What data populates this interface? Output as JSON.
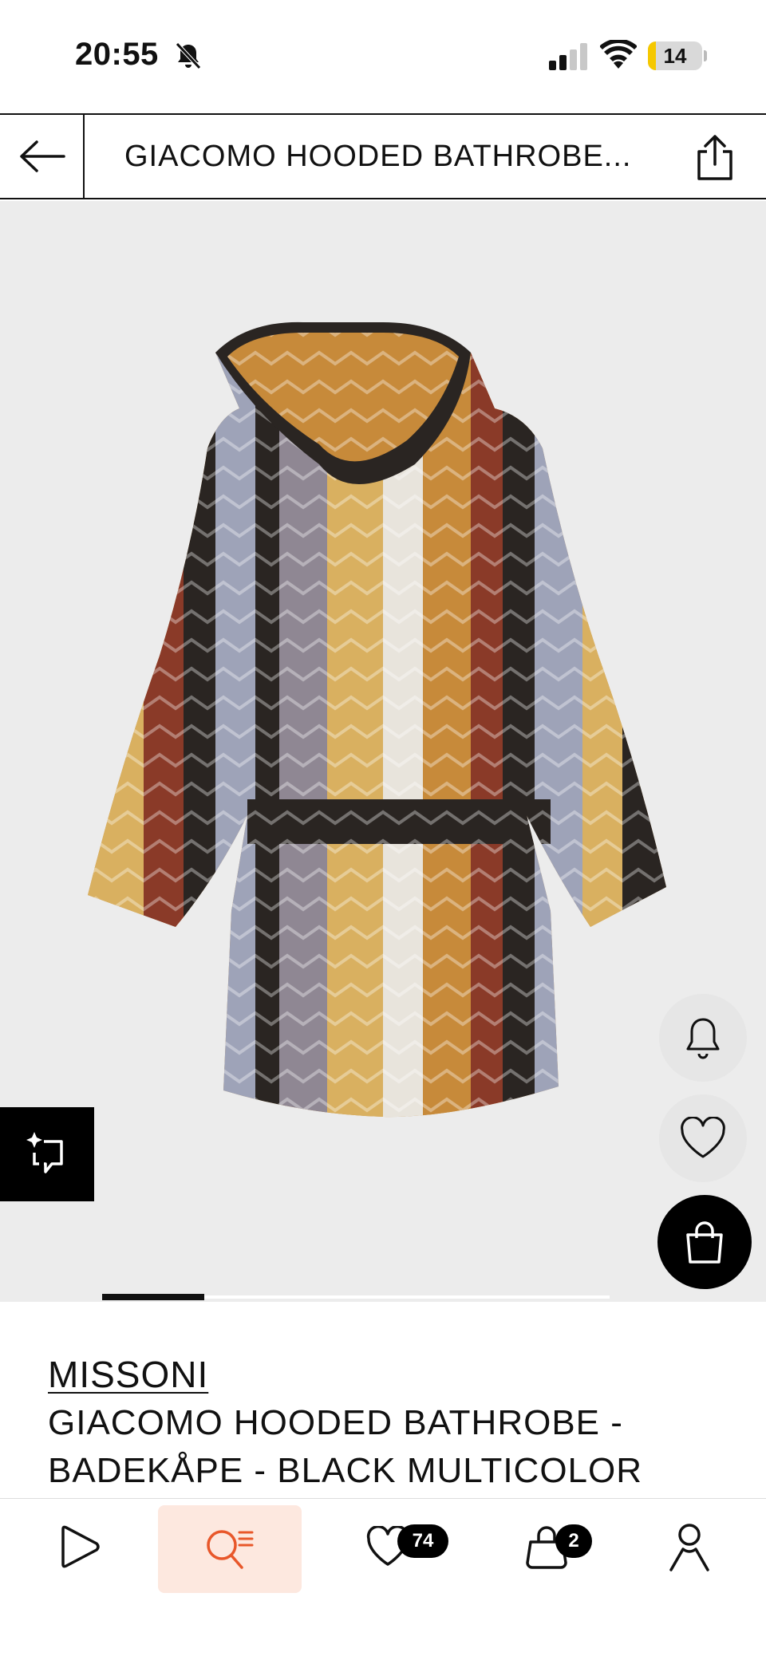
{
  "status_bar": {
    "time": "20:55",
    "battery": "14",
    "battery_level": 0.14
  },
  "header": {
    "title": "GIACOMO HOODED BATHROBE..."
  },
  "product": {
    "brand": "MISSONI",
    "name": "GIACOMO HOODED BATHROBE  - BADEKÅPE - BLACK MULTICOLOR",
    "colors": [
      "#c78a3a",
      "#2a2522",
      "#9ea3b8",
      "#8a3a28",
      "#d9b060",
      "#e8e4dc"
    ]
  },
  "gallery": {
    "active_index": 1
  },
  "nav": {
    "wishlist_count": "74",
    "bag_count": "2"
  },
  "icons": {
    "back": "arrow-left-icon",
    "share": "share-icon",
    "notify": "bell-icon",
    "wishlist": "heart-icon",
    "add_to_bag": "bag-icon",
    "try_on": "sparkle-frame-icon"
  },
  "colors": {
    "search_highlight": "#fde8df",
    "accent": "#e8572a",
    "battery": "#f5c800"
  }
}
